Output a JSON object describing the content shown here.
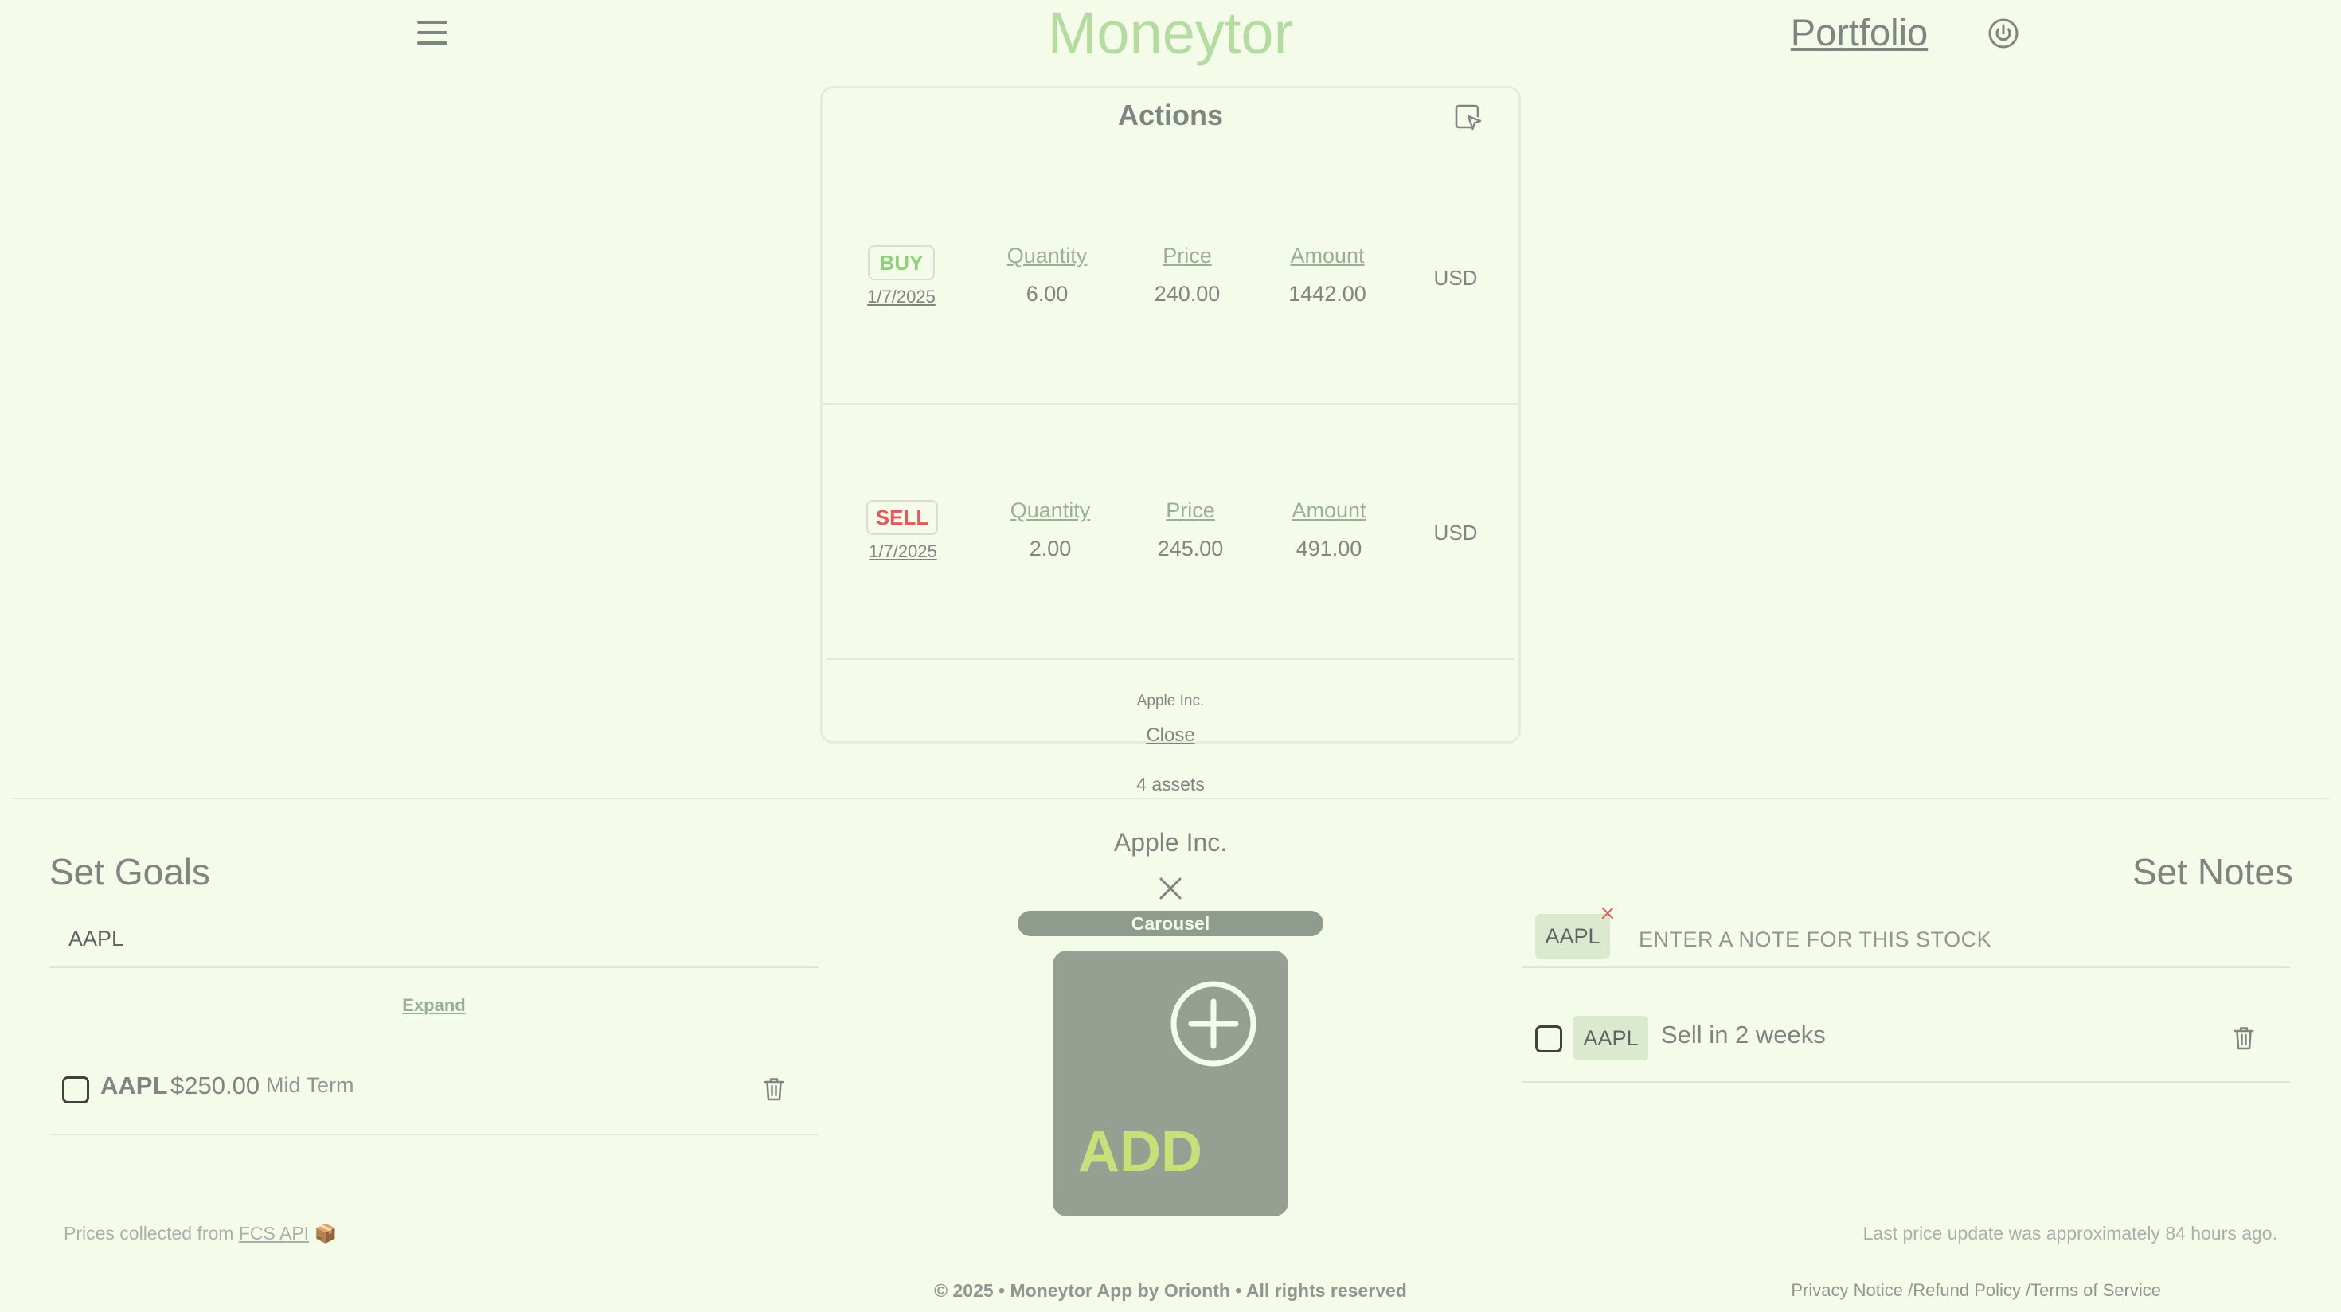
{
  "header": {
    "brand": "Moneytor",
    "nav_portfolio": "Portfolio",
    "icons": {
      "menu": "hamburger-menu-icon",
      "power": "power-icon"
    }
  },
  "actions": {
    "title": "Actions",
    "select_icon": "select-pointer-icon",
    "transactions": [
      {
        "type": "BUY",
        "type_color": "#8fd17a",
        "date": "1/7/2025",
        "quantity_label": "Quantity",
        "quantity": "6.00",
        "price_label": "Price",
        "price": "240.00",
        "amount_label": "Amount",
        "amount": "1442.00",
        "currency": "USD"
      },
      {
        "type": "SELL",
        "type_color": "#e05b5b",
        "date": "1/7/2025",
        "quantity_label": "Quantity",
        "quantity": "2.00",
        "price_label": "Price",
        "price": "245.00",
        "amount_label": "Amount",
        "amount": "491.00",
        "currency": "USD"
      }
    ],
    "asset_name": "Apple Inc.",
    "close_label": "Close",
    "asset_count": "4 assets"
  },
  "goals": {
    "title": "Set Goals",
    "input_value": "AAPL",
    "expand_label": "Expand",
    "items": [
      {
        "ticker": "AAPL",
        "price": "$250.00",
        "term": "Mid Term"
      }
    ]
  },
  "center": {
    "asset_title": "Apple Inc.",
    "carousel_label": "Carousel",
    "add_label": "ADD"
  },
  "notes": {
    "title": "Set Notes",
    "chip_ticker": "AAPL",
    "input_placeholder": "ENTER A NOTE FOR THIS STOCK",
    "items": [
      {
        "ticker": "AAPL",
        "text": "Sell in 2 weeks"
      }
    ]
  },
  "footer": {
    "prices_prefix": "Prices collected from",
    "prices_source": "FCS API",
    "prices_emoji": "📦",
    "last_update": "Last price update was approximately 84 hours ago.",
    "copyright": "© 2025 • Moneytor App by Orionth • All rights reserved",
    "privacy": "Privacy Notice",
    "refund": "/Refund Policy",
    "terms": "/Terms of Service"
  },
  "colors": {
    "background": "#f5fbe9",
    "brand": "#b4dba0",
    "buy": "#8fd17a",
    "sell": "#e05b5b",
    "add_card": "#959f92",
    "add_text": "#c6e07a"
  }
}
